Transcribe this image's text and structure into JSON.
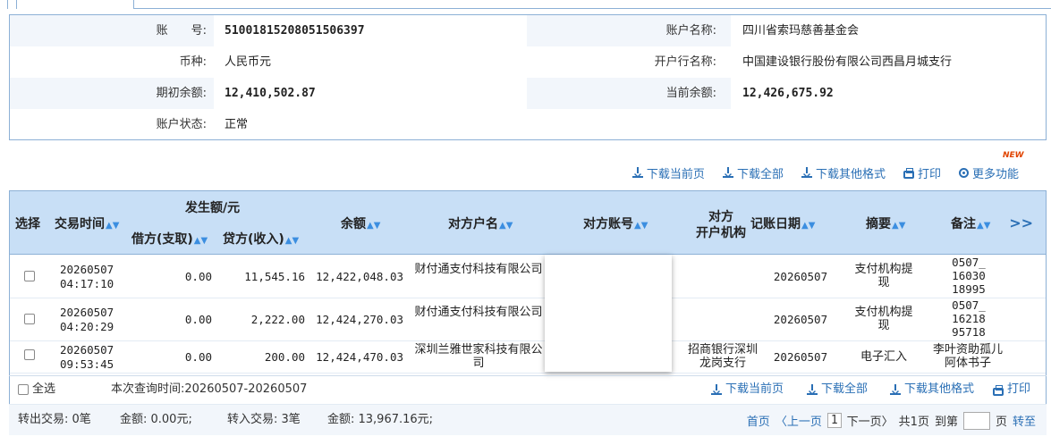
{
  "account": {
    "no_label": "账　　号:",
    "no_value": "51001815208051506397",
    "name_label": "账户名称:",
    "name_value": "四川省索玛慈善基金会",
    "currency_label": "币种:",
    "currency_value": "人民币元",
    "bank_label": "开户行名称:",
    "bank_value": "中国建设银行股份有限公司西昌月城支行",
    "opening_label": "期初余额:",
    "opening_value": "12,410,502.87",
    "current_label": "当前余额:",
    "current_value": "12,426,675.92",
    "status_label": "账户状态:",
    "status_value": "正常"
  },
  "toolbar": {
    "new_badge": "NEW",
    "download_page": "下载当前页",
    "download_all": "下载全部",
    "download_other": "下载其他格式",
    "print": "打印",
    "more": "更多功能"
  },
  "table": {
    "headers": {
      "select": "选择",
      "time": "交易时间",
      "amount_group": "发生额/元",
      "debit": "借方(支取)",
      "credit": "贷方(收入)",
      "balance": "余额",
      "counter_name": "对方户名",
      "counter_account": "对方账号",
      "counter_bank_1": "对方",
      "counter_bank_2": "开户机构",
      "post_date": "记账日期",
      "summary": "摘要",
      "remark": "备注",
      "more": ">>"
    },
    "rows": [
      {
        "date": "20260507",
        "time": "04:17:10",
        "debit": "0.00",
        "credit": "11,545.16",
        "balance": "12,422,048.03",
        "counter_name": "财付通支付科技有限公司",
        "counter_bank": "",
        "post_date": "20260507",
        "summary": "支付机构提现",
        "remark_1": "0507_",
        "remark_2": "16030",
        "remark_3": "18995"
      },
      {
        "date": "20260507",
        "time": "04:20:29",
        "debit": "0.00",
        "credit": "2,222.00",
        "balance": "12,424,270.03",
        "counter_name": "财付通支付科技有限公司",
        "counter_bank": "",
        "post_date": "20260507",
        "summary": "支付机构提现",
        "remark_1": "0507_",
        "remark_2": "16218",
        "remark_3": "95718"
      },
      {
        "date": "20260507",
        "time": "09:53:45",
        "debit": "0.00",
        "credit": "200.00",
        "balance": "12,424,470.03",
        "counter_name": "深圳兰雅世家科技有限公司",
        "counter_bank": "招商银行深圳龙岗支行",
        "post_date": "20260507",
        "summary": "电子汇入",
        "remark_1": "李叶资助孤儿阿体书子",
        "remark_2": "",
        "remark_3": ""
      }
    ]
  },
  "footer": {
    "select_all": "全选",
    "query_time": "本次查询时间:20260507-20260507",
    "download_page": "下载当前页",
    "download_all": "下载全部",
    "download_other": "下载其他格式",
    "print": "打印",
    "out_tx": "转出交易: 0笔",
    "out_amount": "金额: 0.00元;",
    "in_tx": "转入交易: 3笔",
    "in_amount": "金额: 13,967.16元;",
    "first": "首页",
    "prev": "〈上一页",
    "page": "1",
    "next": "下一页〉",
    "total": "共1页",
    "goto": "到第",
    "page_unit": "页",
    "go": "转至"
  }
}
